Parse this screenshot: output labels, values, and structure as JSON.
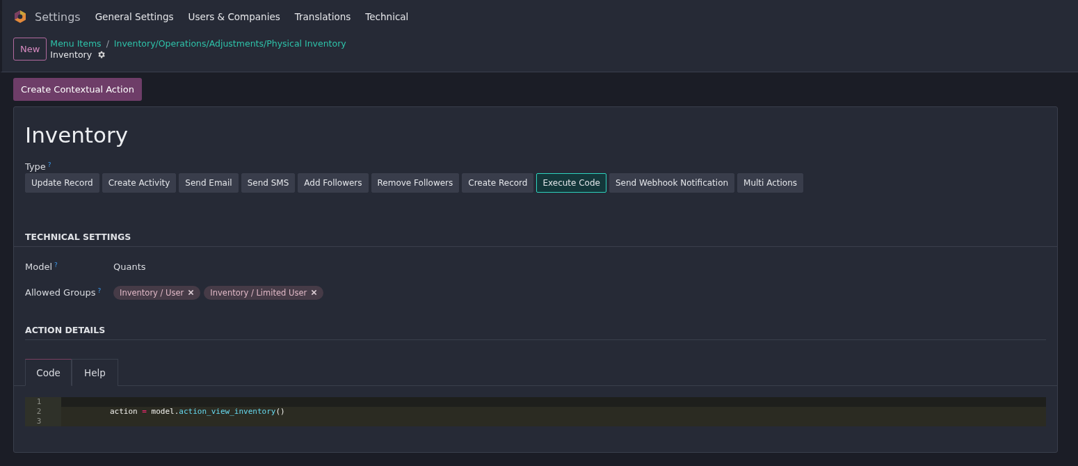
{
  "navbar": {
    "app_name": "Settings",
    "menu": [
      "General Settings",
      "Users & Companies",
      "Translations",
      "Technical"
    ]
  },
  "control_panel": {
    "new_button": "New",
    "breadcrumbs": [
      "Menu Items",
      "Inventory/Operations/Adjustments/Physical Inventory"
    ],
    "separator": "/",
    "current": "Inventory"
  },
  "action_button": "Create Contextual Action",
  "form": {
    "title": "Inventory",
    "type_label": "Type",
    "help_mark": "?",
    "types": [
      {
        "label": "Update Record",
        "selected": false
      },
      {
        "label": "Create Activity",
        "selected": false
      },
      {
        "label": "Send Email",
        "selected": false
      },
      {
        "label": "Send SMS",
        "selected": false
      },
      {
        "label": "Add Followers",
        "selected": false
      },
      {
        "label": "Remove Followers",
        "selected": false
      },
      {
        "label": "Create Record",
        "selected": false
      },
      {
        "label": "Execute Code",
        "selected": true
      },
      {
        "label": "Send Webhook Notification",
        "selected": false
      },
      {
        "label": "Multi Actions",
        "selected": false
      }
    ],
    "technical_heading": "TECHNICAL SETTINGS",
    "model_label": "Model",
    "model_value": "Quants",
    "groups_label": "Allowed Groups",
    "groups": [
      "Inventory / User",
      "Inventory / Limited User"
    ],
    "details_heading": "ACTION DETAILS",
    "tabs": [
      {
        "label": "Code",
        "selected": true
      },
      {
        "label": "Help",
        "selected": false
      }
    ],
    "code_lines": [
      {
        "number": "1"
      },
      {
        "number": "2",
        "tokens": [
          {
            "kind": "plain",
            "text": "action "
          },
          {
            "kind": "op",
            "text": "="
          },
          {
            "kind": "plain",
            "text": " model."
          },
          {
            "kind": "func",
            "text": "action_view_inventory"
          },
          {
            "kind": "plain",
            "text": "()"
          }
        ]
      },
      {
        "number": "3"
      }
    ]
  }
}
